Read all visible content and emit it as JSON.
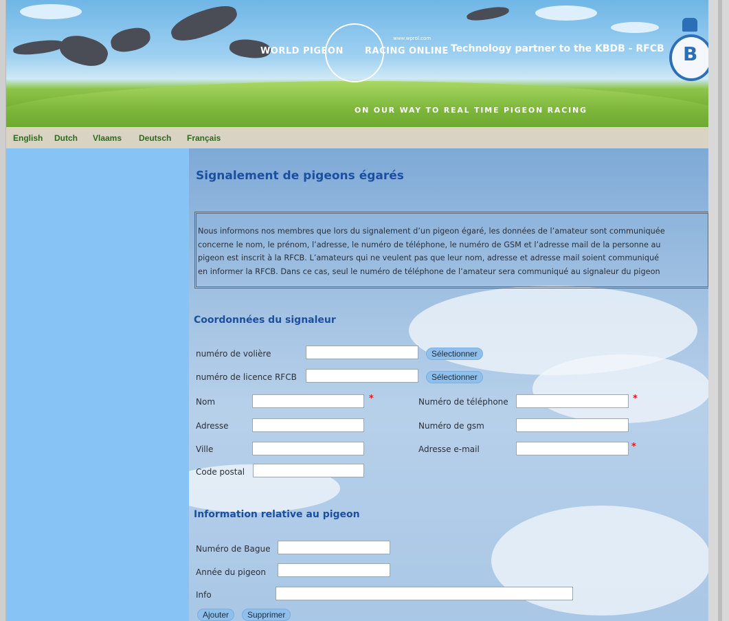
{
  "banner": {
    "logo_left": "WORLD PIGEON",
    "logo_right": "RACING ONLINE",
    "logo_url": "www.wprol.com",
    "partner": "Technology partner to the KBDB - RFCB",
    "badge_letter": "B",
    "tagline": "ON OUR WAY TO REAL TIME PIGEON RACING"
  },
  "languages": [
    "English",
    "Dutch",
    "Vlaams",
    "Deutsch",
    "Français"
  ],
  "page": {
    "title": "Signalement de pigeons égarés",
    "notice_lines": [
      "Nous informons nos membres que lors du signalement d’un pigeon égaré, les données de l’amateur sont communiquée",
      "concerne le nom, le prénom, l’adresse, le numéro de téléphone, le numéro de GSM et l’adresse mail de la personne au",
      "pigeon est inscrit à la RFCB. L’amateurs qui ne veulent pas que leur nom, adresse et adresse mail soient communiqué",
      "en informer la RFCB. Dans ce cas, seul le numéro de téléphone de l’amateur sera communiqué au signaleur du pigeon"
    ]
  },
  "reporter": {
    "heading": "Coordonnées du signaleur",
    "loft_label": "numéro de volière",
    "license_label": "numéro de licence RFCB",
    "select_label": "Sélectionner",
    "name_label": "Nom",
    "address_label": "Adresse",
    "city_label": "Ville",
    "postal_label": "Code postal",
    "phone_label": "Numéro de téléphone",
    "gsm_label": "Numéro de gsm",
    "email_label": "Adresse e-mail",
    "required_mark": "*"
  },
  "pigeon": {
    "heading": "Information relative au pigeon",
    "ring_label": "Numéro de Bague",
    "year_label": "Année du pigeon",
    "info_label": "Info",
    "add_label": "Ajouter",
    "delete_label": "Supprimer"
  },
  "colors": {
    "heading": "#1b4fa0",
    "sidebar": "#87c3f5",
    "lang_link": "#2d6a1b",
    "button": "#8fc0ec",
    "required": "#e31b1b"
  }
}
